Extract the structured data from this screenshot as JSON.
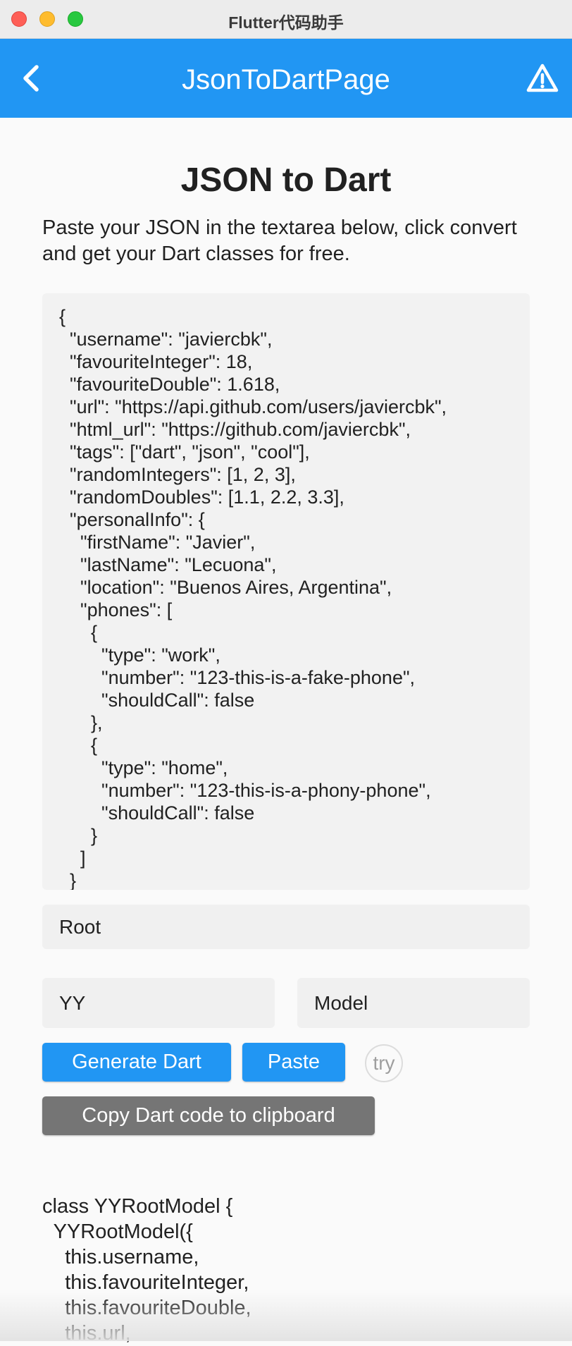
{
  "window": {
    "title": "Flutter代码助手"
  },
  "appbar": {
    "title": "JsonToDartPage",
    "back_icon": "chevron-left-icon",
    "action_icon": "warning-icon"
  },
  "main": {
    "heading": "JSON to Dart",
    "description": "Paste your JSON in the textarea below, click convert and get your Dart classes for free.",
    "json_input": "{\n  \"username\": \"javiercbk\",\n  \"favouriteInteger\": 18,\n  \"favouriteDouble\": 1.618,\n  \"url\": \"https://api.github.com/users/javiercbk\",\n  \"html_url\": \"https://github.com/javiercbk\",\n  \"tags\": [\"dart\", \"json\", \"cool\"],\n  \"randomIntegers\": [1, 2, 3],\n  \"randomDoubles\": [1.1, 2.2, 3.3],\n  \"personalInfo\": {\n    \"firstName\": \"Javier\",\n    \"lastName\": \"Lecuona\",\n    \"location\": \"Buenos Aires, Argentina\",\n    \"phones\": [\n      {\n        \"type\": \"work\",\n        \"number\": \"123-this-is-a-fake-phone\",\n        \"shouldCall\": false\n      },\n      {\n        \"type\": \"home\",\n        \"number\": \"123-this-is-a-phony-phone\",\n        \"shouldCall\": false\n      }\n    ]\n  }\n}",
    "root_class_value": "Root",
    "prefix_value": "YY",
    "suffix_value": "Model",
    "generate_label": "Generate Dart",
    "paste_label": "Paste",
    "try_label": "try",
    "copy_label": "Copy Dart code to clipboard",
    "dart_output": "class YYRootModel {\n  YYRootModel({\n    this.username,\n    this.favouriteInteger,\n    this.favouriteDouble,\n    this.url,"
  },
  "colors": {
    "primary": "#2196f3",
    "copy_button": "#757575"
  }
}
